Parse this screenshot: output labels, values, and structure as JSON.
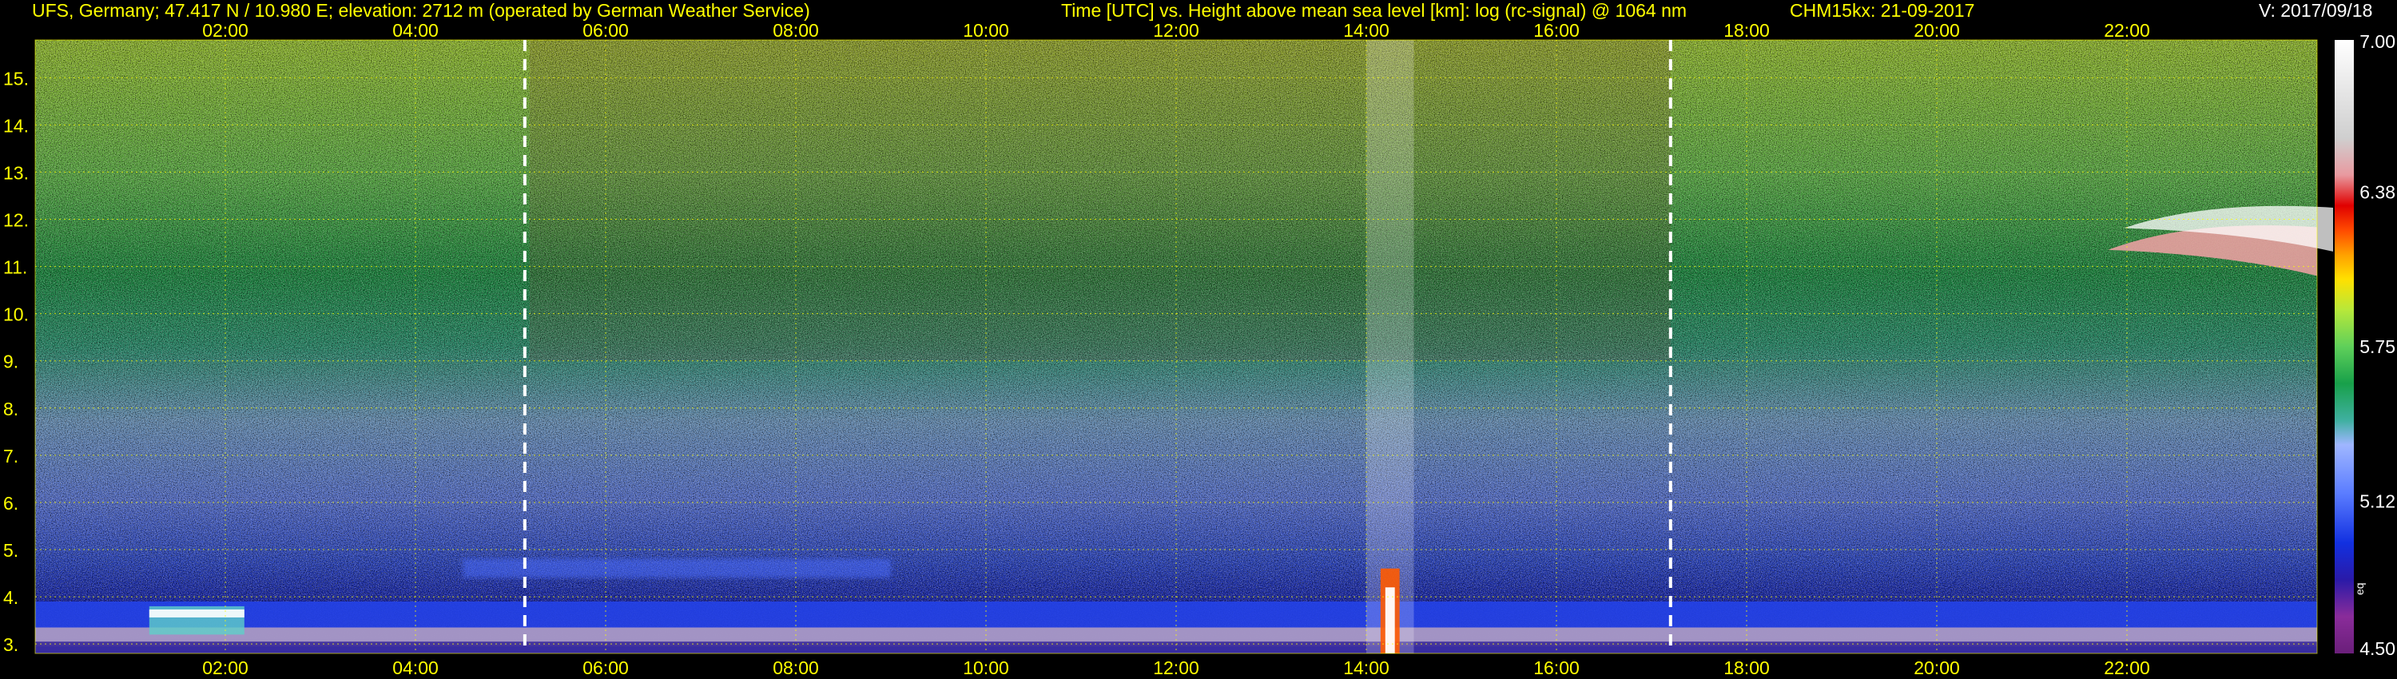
{
  "header": {
    "site": "UFS, Germany; 47.417 N / 10.980 E; elevation: 2712 m  (operated by German Weather Service)",
    "title": "Time [UTC] vs. Height above mean sea level [km]: log (rc-signal) @ 1064 nm",
    "instrument": "CHM15kx: 21-09-2017",
    "version": "V: 2017/09/18"
  },
  "chart_data": {
    "type": "heatmap",
    "title": "Time [UTC] vs. Height above mean sea level [km]: log (rc-signal) @ 1064 nm",
    "xlabel": "Time [UTC]",
    "ylabel": "Height above mean sea level [km]",
    "x_unit": "hours UTC",
    "xlim": [
      0,
      24
    ],
    "ylim": [
      2.8,
      15.8
    ],
    "x_ticks": [
      "02:00",
      "04:00",
      "06:00",
      "08:00",
      "10:00",
      "12:00",
      "14:00",
      "16:00",
      "18:00",
      "20:00",
      "22:00"
    ],
    "x_tick_values": [
      2,
      4,
      6,
      8,
      10,
      12,
      14,
      16,
      18,
      20,
      22
    ],
    "y_ticks": [
      "3.",
      "4.",
      "5.",
      "6.",
      "7.",
      "8.",
      "9.",
      "10.",
      "11.",
      "12.",
      "13.",
      "14.",
      "15."
    ],
    "y_tick_values": [
      3,
      4,
      5,
      6,
      7,
      8,
      9,
      10,
      11,
      12,
      13,
      14,
      15
    ],
    "grid": true,
    "markers_utc": [
      5.15,
      17.2
    ],
    "colorbar": {
      "min": 4.5,
      "max": 7.0,
      "ticks": [
        "7.00",
        "6.38",
        "5.75",
        "5.12",
        "4.50"
      ],
      "tick_values": [
        7.0,
        6.38,
        5.75,
        5.12,
        4.5
      ],
      "unit": "eq"
    },
    "features": [
      {
        "name": "boundary layer aerosol",
        "t_start": 0.0,
        "t_end": 24.0,
        "z_bottom": 2.8,
        "z_top": 3.9,
        "value": 5.0
      },
      {
        "name": "residual aerosol layer",
        "t_start": 4.5,
        "t_end": 9.0,
        "z_bottom": 4.4,
        "z_top": 4.8,
        "value": 5.1
      },
      {
        "name": "low cloud",
        "t_start": 1.2,
        "t_end": 2.2,
        "z_bottom": 3.2,
        "z_top": 3.8,
        "value": 6.4
      },
      {
        "name": "convective plume",
        "t_start": 14.0,
        "t_end": 14.5,
        "z_bottom": 2.8,
        "z_top": 15.8,
        "value": 6.9
      },
      {
        "name": "cirrus cloud",
        "t_start": 21.8,
        "t_end": 24.0,
        "z_bottom": 10.8,
        "z_top": 11.9,
        "value": 7.0
      }
    ]
  }
}
